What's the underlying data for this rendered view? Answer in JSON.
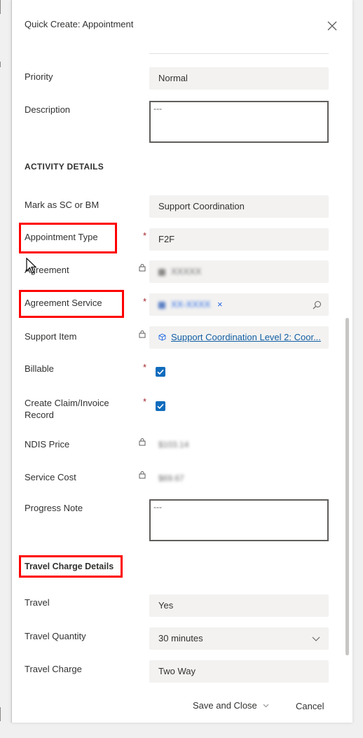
{
  "header": {
    "title": "Quick Create: Appointment",
    "close_glyph": "✕"
  },
  "fields": {
    "priority": {
      "label": "Priority",
      "value": "Normal"
    },
    "description": {
      "label": "Description",
      "value": "---"
    },
    "activity_section": "ACTIVITY DETAILS",
    "mark_sc_bm": {
      "label": "Mark as SC or BM",
      "value": "Support Coordination"
    },
    "appointment_type": {
      "label": "Appointment Type",
      "value": "F2F"
    },
    "agreement": {
      "label": "Agreement",
      "value": "XXXXX"
    },
    "agreement_service": {
      "label": "Agreement Service",
      "value": "XX-XXXX",
      "remove_glyph": "×"
    },
    "support_item": {
      "label": "Support Item",
      "value": "Support Coordination Level 2: Coor..."
    },
    "billable": {
      "label": "Billable",
      "checked": true
    },
    "create_claim": {
      "label": "Create Claim/Invoice Record",
      "checked": true
    },
    "ndis_price": {
      "label": "NDIS Price",
      "value": "$103.14"
    },
    "service_cost": {
      "label": "Service Cost",
      "value": "$69.67"
    },
    "progress_note": {
      "label": "Progress Note",
      "value": "---"
    },
    "travel_section": "Travel Charge Details",
    "travel": {
      "label": "Travel",
      "value": "Yes"
    },
    "travel_quantity": {
      "label": "Travel Quantity",
      "value": "30 minutes"
    },
    "travel_charge": {
      "label": "Travel Charge",
      "value": "Two Way"
    }
  },
  "required_marker": "*",
  "footer": {
    "save_label": "Save and Close",
    "save_chevron": "⌵",
    "cancel_label": "Cancel"
  },
  "colors": {
    "highlight": "#ff0000",
    "checkbox": "#0f6cbd",
    "required": "#a4262c",
    "link": "#115ea3"
  }
}
